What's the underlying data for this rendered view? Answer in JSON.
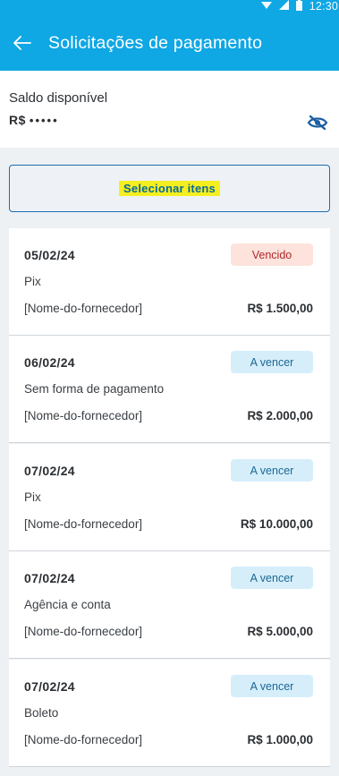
{
  "status_bar": {
    "time": "12:30"
  },
  "header": {
    "title": "Solicitações de pagamento"
  },
  "balance": {
    "label": "Saldo disponível",
    "currency": "R$",
    "masked_value": "•••••"
  },
  "select": {
    "label": "Selecionar itens"
  },
  "colors": {
    "accent": "#0fa7e4",
    "overdue_bg": "#fde3dc",
    "due_bg": "#d6eefa",
    "highlight": "#f6ef1f"
  },
  "items": [
    {
      "date": "05/02/24",
      "status": "Vencido",
      "status_type": "overdue",
      "method": "Pix",
      "supplier": "[Nome-do-fornecedor]",
      "amount": "R$ 1.500,00"
    },
    {
      "date": "06/02/24",
      "status": "A vencer",
      "status_type": "due",
      "method": "Sem forma de pagamento",
      "supplier": "[Nome-do-fornecedor]",
      "amount": "R$ 2.000,00"
    },
    {
      "date": "07/02/24",
      "status": "A vencer",
      "status_type": "due",
      "method": "Pix",
      "supplier": "[Nome-do-fornecedor]",
      "amount": "R$ 10.000,00"
    },
    {
      "date": "07/02/24",
      "status": "A vencer",
      "status_type": "due",
      "method": "Agência e conta",
      "supplier": "[Nome-do-fornecedor]",
      "amount": "R$ 5.000,00"
    },
    {
      "date": "07/02/24",
      "status": "A vencer",
      "status_type": "due",
      "method": "Boleto",
      "supplier": "[Nome-do-fornecedor]",
      "amount": "R$ 1.000,00"
    }
  ]
}
